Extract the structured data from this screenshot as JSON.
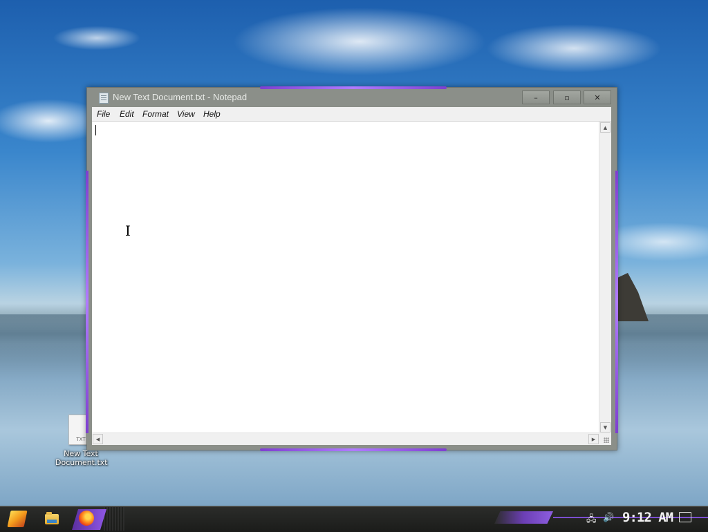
{
  "window": {
    "title": "New Text Document.txt - Notepad",
    "controls": {
      "minimize": "–",
      "maximize": "▫",
      "close": "✕"
    }
  },
  "menu": [
    {
      "label": "File"
    },
    {
      "label": "Edit"
    },
    {
      "label": "Format"
    },
    {
      "label": "View"
    },
    {
      "label": "Help"
    }
  ],
  "editor": {
    "content": ""
  },
  "scrollbar": {
    "up": "▲",
    "down": "▼",
    "left": "◀",
    "right": "▶"
  },
  "desktop_icons": [
    {
      "name": "New Text Document.txt",
      "line1": "New Text",
      "line2": "Document.txt",
      "badge": "TXT"
    }
  ],
  "taskbar": {
    "clock": "9:12 AM",
    "tray": {
      "network": "🖧",
      "volume": "🔊"
    }
  },
  "colors": {
    "accent": "#8a55e0",
    "titlebar": "#8b8f89"
  }
}
